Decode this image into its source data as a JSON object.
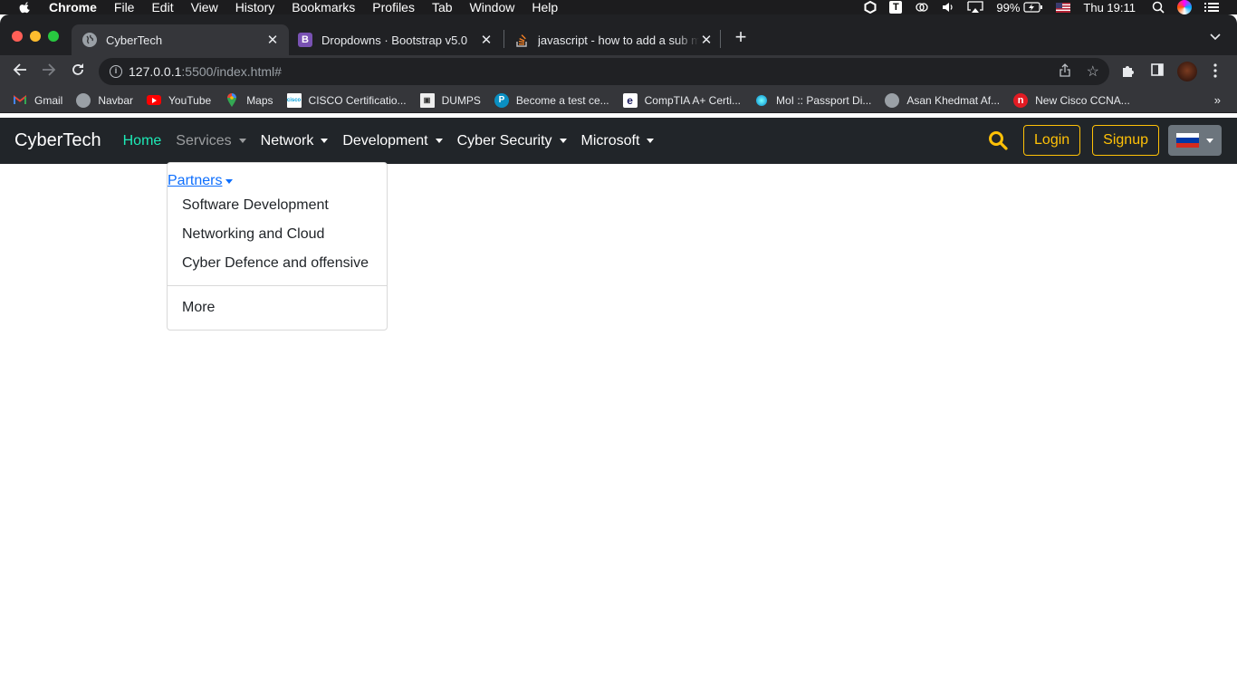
{
  "menubar": {
    "app": "Chrome",
    "items": [
      "File",
      "Edit",
      "View",
      "History",
      "Bookmarks",
      "Profiles",
      "Tab",
      "Window",
      "Help"
    ],
    "battery": "99%",
    "clock": "Thu 19:11"
  },
  "tabs": [
    {
      "title": "CyberTech",
      "icon": "globe-icon",
      "active": true
    },
    {
      "title": "Dropdowns · Bootstrap v5.0",
      "icon": "bootstrap-icon",
      "active": false
    },
    {
      "title": "javascript - how to add a sub m",
      "icon": "stackoverflow-icon",
      "active": false
    }
  ],
  "address": {
    "host": "127.0.0.1",
    "rest": ":5500/index.html#"
  },
  "bookmarks": [
    {
      "label": "Gmail",
      "icon": "gmail-icon"
    },
    {
      "label": "Navbar",
      "icon": "globe-icon"
    },
    {
      "label": "YouTube",
      "icon": "youtube-icon"
    },
    {
      "label": "Maps",
      "icon": "maps-icon"
    },
    {
      "label": "CISCO Certificatio...",
      "icon": "cisco-icon"
    },
    {
      "label": "DUMPS",
      "icon": "dumps-icon"
    },
    {
      "label": "Become a test ce...",
      "icon": "pearson-icon"
    },
    {
      "label": "CompTIA A+ Certi...",
      "icon": "comptia-icon"
    },
    {
      "label": "MoI :: Passport Di...",
      "icon": "passport-icon"
    },
    {
      "label": "Asan Khedmat Af...",
      "icon": "globe-icon"
    },
    {
      "label": "New Cisco CCNA...",
      "icon": "netacad-icon"
    }
  ],
  "bookmarks_more": "»",
  "site": {
    "brand": "CyberTech",
    "nav": [
      {
        "label": "Home",
        "state": "active",
        "dropdown": false
      },
      {
        "label": "Services",
        "state": "muted",
        "dropdown": true
      },
      {
        "label": "Network",
        "state": "normal",
        "dropdown": true
      },
      {
        "label": "Development",
        "state": "normal",
        "dropdown": true
      },
      {
        "label": "Cyber Security",
        "state": "normal",
        "dropdown": true
      },
      {
        "label": "Microsoft",
        "state": "normal",
        "dropdown": true
      }
    ],
    "login": "Login",
    "signup": "Signup",
    "language_flag": "russia-flag-icon",
    "colors": {
      "accent": "#1de9b6",
      "warning": "#ffc107",
      "navbar": "#212529",
      "link": "#0d6efd"
    }
  },
  "dropdown": {
    "header": "Partners",
    "items": [
      "Software Development",
      "Networking and Cloud",
      "Cyber Defence and offensive"
    ],
    "footer_item": "More"
  }
}
